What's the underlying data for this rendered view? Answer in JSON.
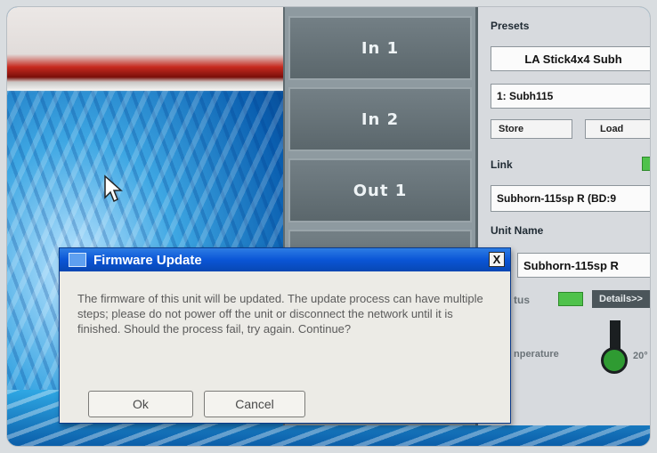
{
  "channels": [
    {
      "label": "In 1"
    },
    {
      "label": "In 2"
    },
    {
      "label": "Out 1"
    }
  ],
  "panel": {
    "presets_label": "Presets",
    "preset_group": "LA Stick4x4 Subh",
    "preset_selected": "1: Subh115",
    "store_label": "Store",
    "load_label": "Load",
    "link_label": "Link",
    "link_device": "Subhorn-115sp R (BD:9",
    "unit_name_label": "Unit Name",
    "unit_name_value": "Subhorn-115sp R",
    "status_label": "tus",
    "details_label": "Details>>",
    "temperature_label": "nperature",
    "temperature_value": "20°"
  },
  "dialog": {
    "title": "Firmware Update",
    "close_glyph": "X",
    "message": "The firmware of this unit will be updated. The update process can have multiple steps; please do not power off the unit or disconnect the network until it is finished. Should the process fail, try again. Continue?",
    "ok_label": "Ok",
    "cancel_label": "Cancel"
  },
  "colors": {
    "titlebar": "#0a55d6",
    "led_green": "#4fc24b",
    "channel_bg": "#5a666b"
  }
}
